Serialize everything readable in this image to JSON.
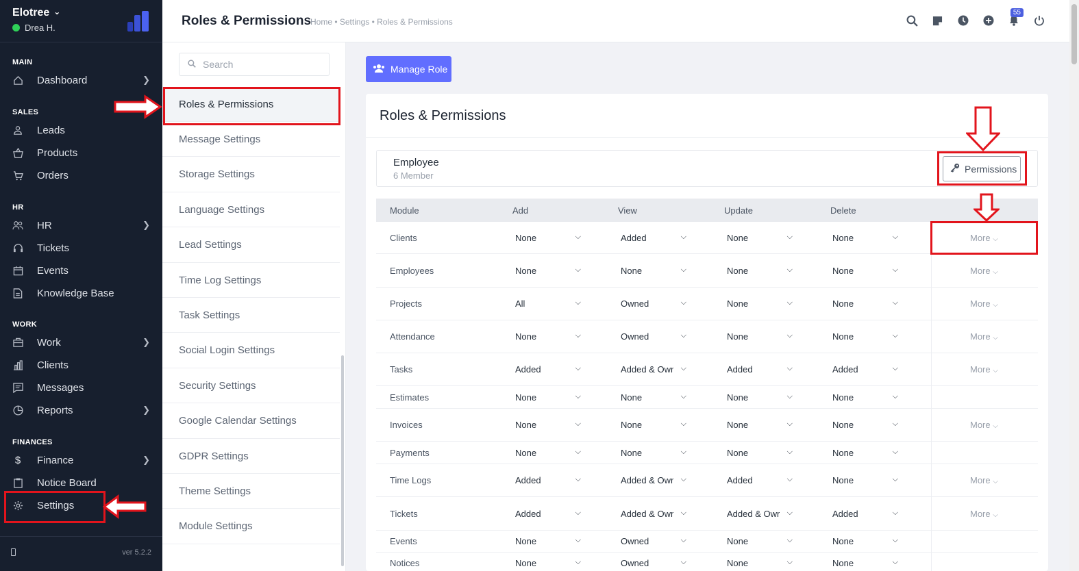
{
  "nav": {
    "company": "Elotree",
    "user": "Drea H.",
    "version": "ver 5.2.2",
    "sections": [
      {
        "title": "MAIN",
        "items": [
          {
            "label": "Dashboard",
            "icon": "home-icon",
            "arrow": true
          }
        ]
      },
      {
        "title": "SALES",
        "items": [
          {
            "label": "Leads",
            "icon": "user-icon",
            "arrow": false
          },
          {
            "label": "Products",
            "icon": "basket-icon",
            "arrow": false
          },
          {
            "label": "Orders",
            "icon": "cart-icon",
            "arrow": false
          }
        ]
      },
      {
        "title": "HR",
        "items": [
          {
            "label": "HR",
            "icon": "people-icon",
            "arrow": true
          },
          {
            "label": "Tickets",
            "icon": "headset-icon",
            "arrow": false
          },
          {
            "label": "Events",
            "icon": "calendar-icon",
            "arrow": false
          },
          {
            "label": "Knowledge Base",
            "icon": "book-icon",
            "arrow": false
          }
        ]
      },
      {
        "title": "WORK",
        "items": [
          {
            "label": "Work",
            "icon": "briefcase-icon",
            "arrow": true
          },
          {
            "label": "Clients",
            "icon": "building-icon",
            "arrow": false
          },
          {
            "label": "Messages",
            "icon": "message-icon",
            "arrow": false
          },
          {
            "label": "Reports",
            "icon": "pie-icon",
            "arrow": true
          }
        ]
      },
      {
        "title": "FINANCES",
        "items": [
          {
            "label": "Finance",
            "icon": "dollar-icon",
            "arrow": true
          },
          {
            "label": "Notice Board",
            "icon": "clipboard-icon",
            "arrow": false
          },
          {
            "label": "Settings",
            "icon": "gear-icon",
            "arrow": false
          }
        ]
      }
    ]
  },
  "header": {
    "title": "Roles & Permissions",
    "breadcrumb": "Home • Settings • Roles & Permissions",
    "notification_count": "55"
  },
  "settings_menu": {
    "search_placeholder": "Search",
    "items": [
      "Roles & Permissions",
      "Message Settings",
      "Storage Settings",
      "Language Settings",
      "Lead Settings",
      "Time Log Settings",
      "Task Settings",
      "Social Login Settings",
      "Security Settings",
      "Google Calendar Settings",
      "GDPR Settings",
      "Theme Settings",
      "Module Settings"
    ],
    "active_index": 0
  },
  "main": {
    "manage_role_label": "Manage Role",
    "card_title": "Roles & Permissions",
    "role": {
      "name": "Employee",
      "members": "6 Member",
      "permissions_label": "Permissions"
    },
    "table": {
      "headers": [
        "Module",
        "Add",
        "View",
        "Update",
        "Delete"
      ],
      "more_label": "More",
      "rows": [
        {
          "module": "Clients",
          "add": "None",
          "view": "Added",
          "update": "None",
          "delete": "None",
          "more": true
        },
        {
          "module": "Employees",
          "add": "None",
          "view": "None",
          "update": "None",
          "delete": "None",
          "more": true
        },
        {
          "module": "Projects",
          "add": "All",
          "view": "Owned",
          "update": "None",
          "delete": "None",
          "more": true
        },
        {
          "module": "Attendance",
          "add": "None",
          "view": "Owned",
          "update": "None",
          "delete": "None",
          "more": true
        },
        {
          "module": "Tasks",
          "add": "Added",
          "view": "Added & Owr",
          "update": "Added",
          "delete": "Added",
          "more": true
        },
        {
          "module": "Estimates",
          "add": "None",
          "view": "None",
          "update": "None",
          "delete": "None",
          "more": false
        },
        {
          "module": "Invoices",
          "add": "None",
          "view": "None",
          "update": "None",
          "delete": "None",
          "more": true
        },
        {
          "module": "Payments",
          "add": "None",
          "view": "None",
          "update": "None",
          "delete": "None",
          "more": false
        },
        {
          "module": "Time Logs",
          "add": "Added",
          "view": "Added & Owr",
          "update": "Added",
          "delete": "None",
          "more": true
        },
        {
          "module": "Tickets",
          "add": "Added",
          "view": "Added & Owr",
          "update": "Added & Owr",
          "delete": "Added",
          "more": true
        },
        {
          "module": "Events",
          "add": "None",
          "view": "Owned",
          "update": "None",
          "delete": "None",
          "more": false
        },
        {
          "module": "Notices",
          "add": "None",
          "view": "Owned",
          "update": "None",
          "delete": "None",
          "more": false
        }
      ]
    }
  },
  "colors": {
    "sidebar_bg": "#171f2e",
    "primary": "#616eff",
    "annotation_red": "#e2141c",
    "online_dot": "#2fd158"
  }
}
